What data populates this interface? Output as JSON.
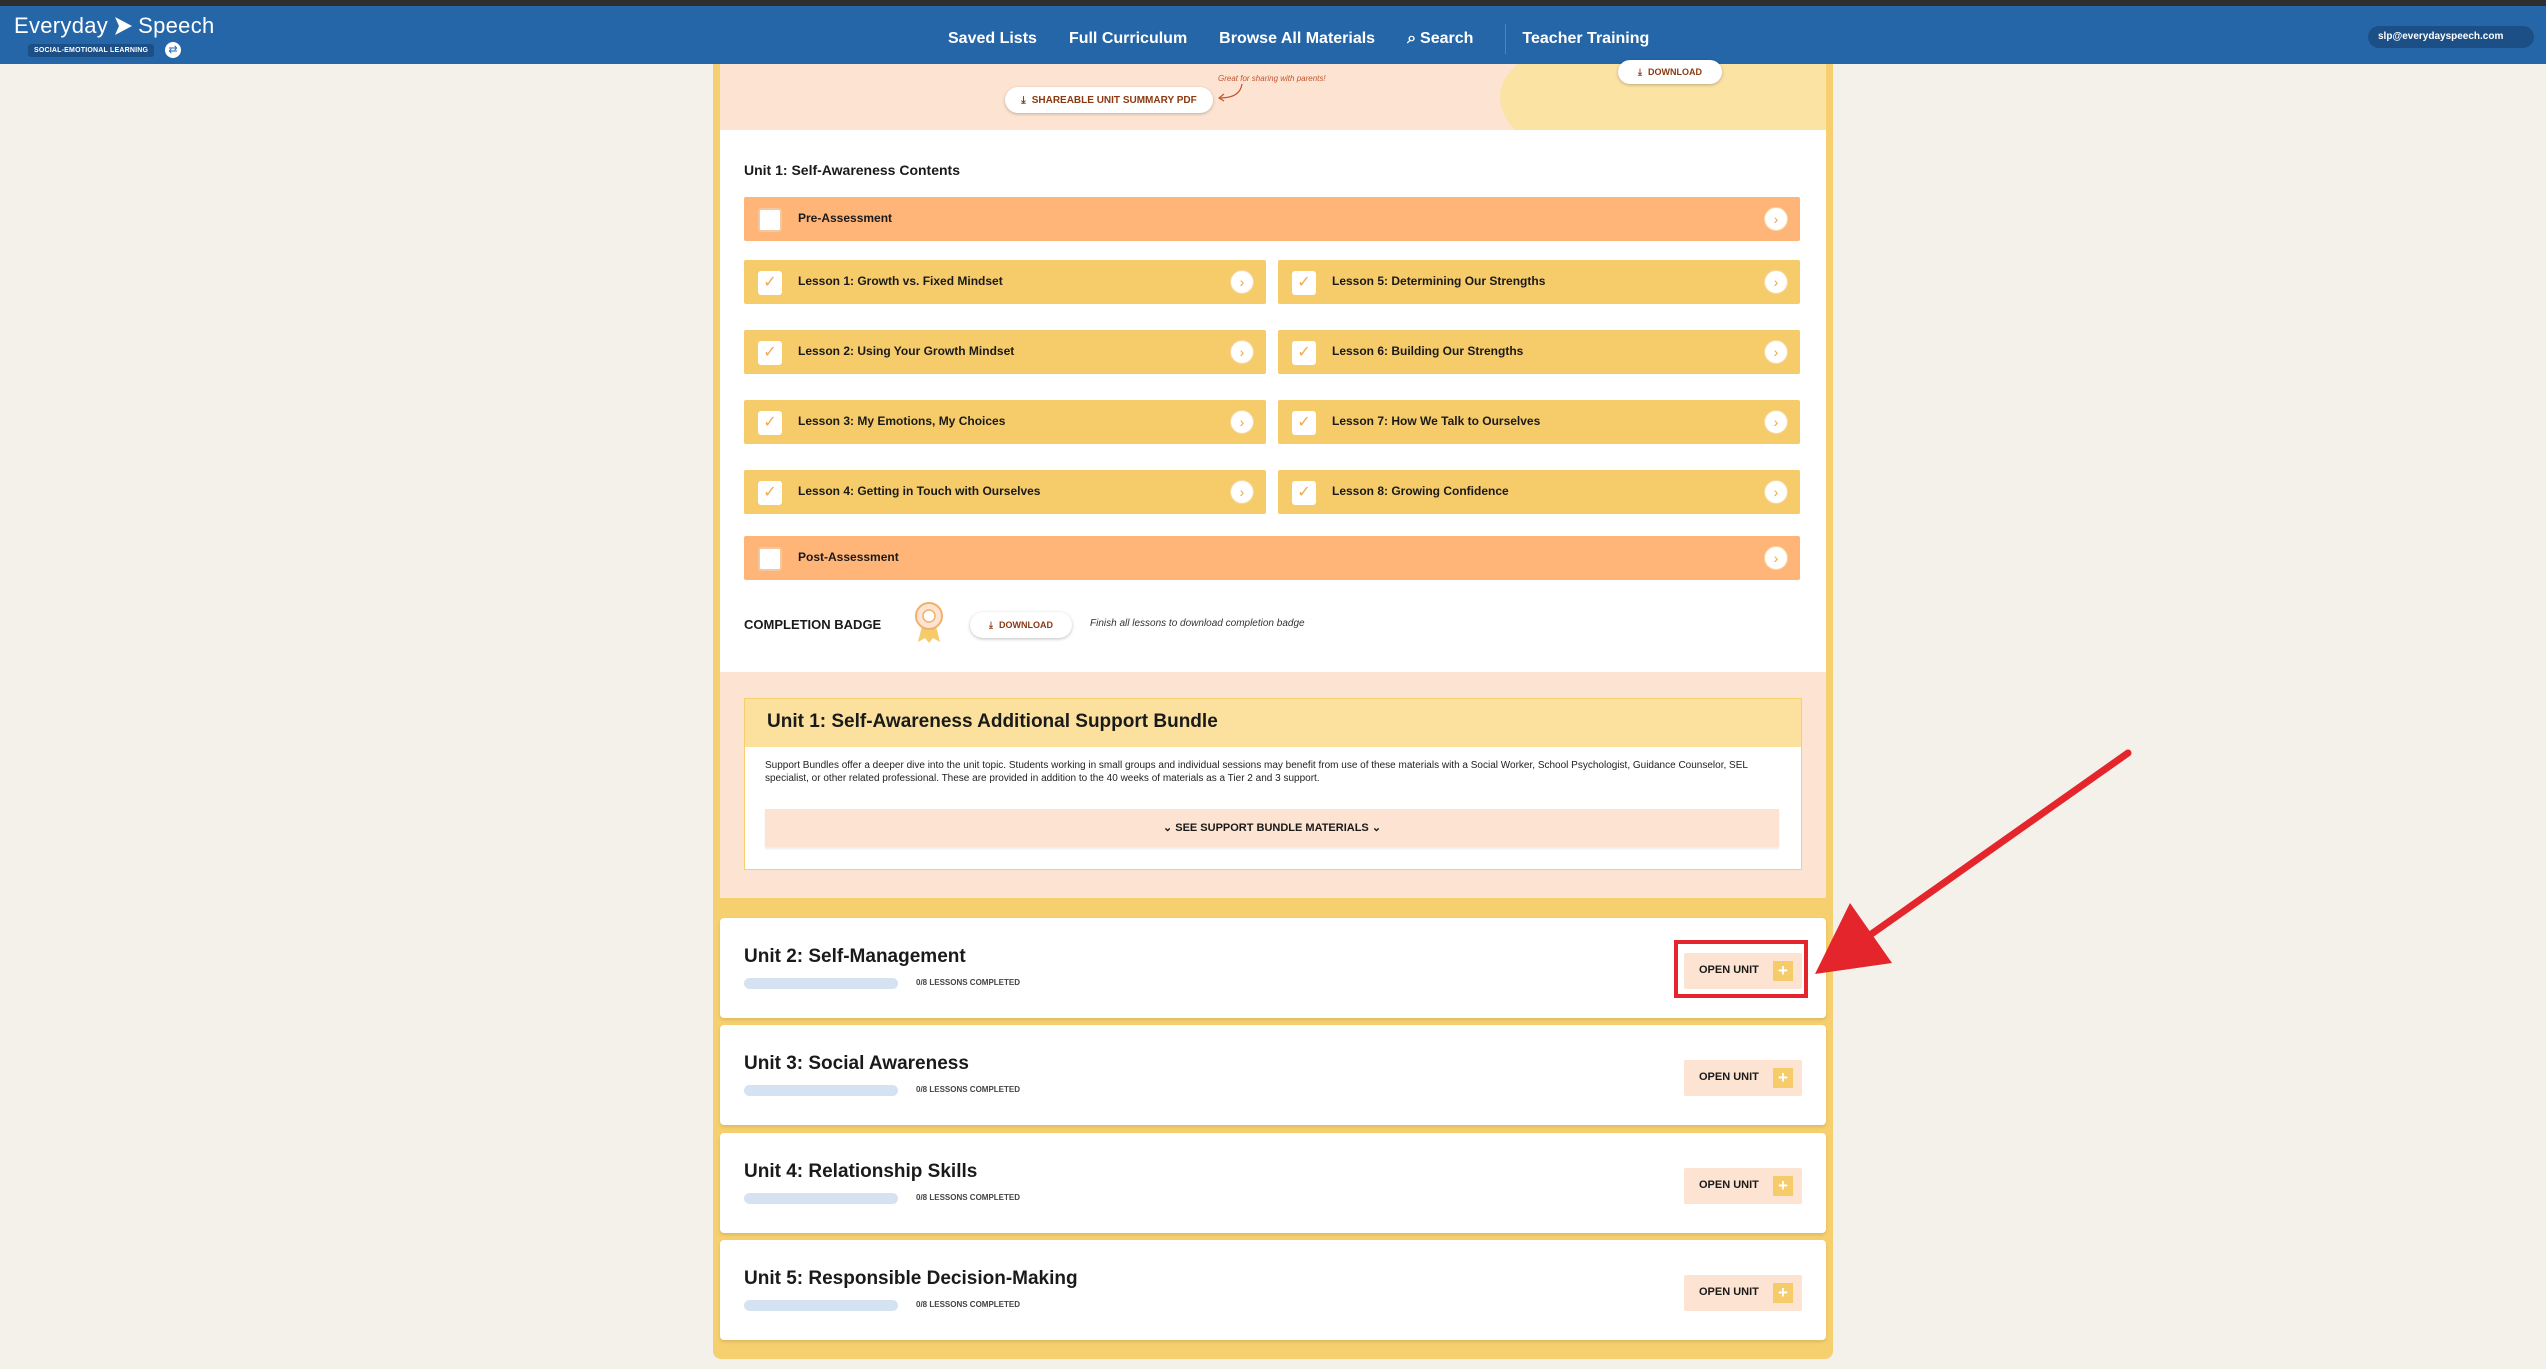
{
  "nav": {
    "logo_text_1": "Everyday",
    "logo_text_2": "Speech",
    "logo_sub": "SOCIAL-EMOTIONAL LEARNING",
    "links": [
      "Saved Lists",
      "Full Curriculum",
      "Browse All Materials",
      "Search",
      "Teacher Training"
    ],
    "user_email": "slp@everydayspeech.com"
  },
  "hero": {
    "download_label": "DOWNLOAD",
    "shareable_label": "SHAREABLE UNIT SUMMARY PDF",
    "note": "Great for sharing with parents!"
  },
  "unit1": {
    "contents_title": "Unit 1: Self-Awareness Contents",
    "pre_assessment": "Pre-Assessment",
    "post_assessment": "Post-Assessment",
    "lessons_left": [
      "Lesson 1: Growth vs. Fixed Mindset",
      "Lesson 2: Using Your Growth Mindset",
      "Lesson 3: My Emotions, My Choices",
      "Lesson 4: Getting in Touch with Ourselves"
    ],
    "lessons_right": [
      "Lesson 5: Determining Our Strengths",
      "Lesson 6: Building Our Strengths",
      "Lesson 7: How We Talk to Ourselves",
      "Lesson 8: Growing Confidence"
    ],
    "badge_title": "COMPLETION BADGE",
    "badge_download": "DOWNLOAD",
    "badge_note": "Finish all lessons to download completion badge"
  },
  "support": {
    "title": "Unit 1: Self-Awareness Additional Support Bundle",
    "description": "Support Bundles offer a deeper dive into the unit topic. Students working in small groups and individual sessions may benefit from use of these materials with a Social Worker, School Psychologist, Guidance Counselor, SEL specialist, or other related professional. These are provided in addition to the 40 weeks of materials as a Tier 2 and 3 support.",
    "see_label": "SEE SUPPORT BUNDLE MATERIALS"
  },
  "units": [
    {
      "name": "Unit 2: Self-Management",
      "progress": "0/8 LESSONS COMPLETED",
      "progress_fraction": 0,
      "open_label": "OPEN UNIT"
    },
    {
      "name": "Unit 3: Social Awareness",
      "progress": "0/8 LESSONS COMPLETED",
      "progress_fraction": 0,
      "open_label": "OPEN UNIT"
    },
    {
      "name": "Unit 4: Relationship Skills",
      "progress": "0/8 LESSONS COMPLETED",
      "progress_fraction": 0,
      "open_label": "OPEN UNIT"
    },
    {
      "name": "Unit 5: Responsible Decision-Making",
      "progress": "0/8 LESSONS COMPLETED",
      "progress_fraction": 0,
      "open_label": "OPEN UNIT"
    }
  ],
  "colors": {
    "nav_blue": "#2566a8",
    "orange_row": "#ffb478",
    "yellow_row": "#f6cb6a",
    "annotation_red": "#e4262c"
  }
}
